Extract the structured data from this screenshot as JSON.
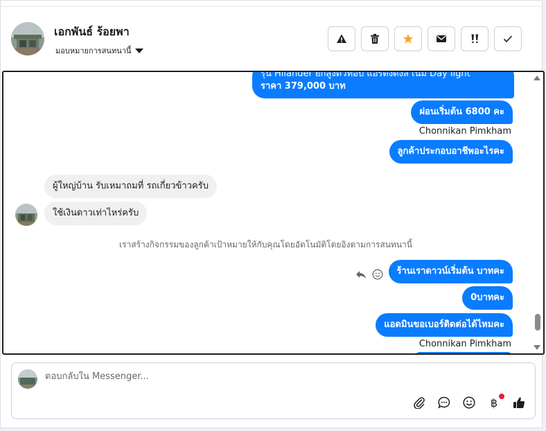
{
  "contact": {
    "name": "เอกพันธ์ ร้อยพา",
    "assign_label": "มอบหมายการสนทนานี้"
  },
  "actions": [
    {
      "name": "report-button",
      "icon": "warning-icon"
    },
    {
      "name": "delete-button",
      "icon": "trash-icon"
    },
    {
      "name": "star-button",
      "icon": "star-icon",
      "color": "#f5a623"
    },
    {
      "name": "mark-unread-button",
      "icon": "envelope-icon"
    },
    {
      "name": "follow-up-button",
      "icon": "double-exclamation-icon"
    },
    {
      "name": "mark-done-button",
      "icon": "checkmark-icon"
    }
  ],
  "messages": {
    "m1_line1": "รุ่น Hilander ยกสูงตัวท็อป แอร์ดงดังส์ เน้ม Day light",
    "m1_line2": "ราคา 379,000 บาท",
    "m2": "ผ่อนเริ่มต้น 6800 คะ",
    "sender1": "Chonnikan Pimkham",
    "m3": "ลูกค้าประกอบอาชีพอะไรคะ",
    "m4": "ผู้ใหญ่บ้าน   รับเหมาถมที่  รถเกี่ยวข้าวครับ",
    "m5": "ใช้เงินดาวเท่าไหร่ครับ",
    "system": "เราสร้างกิจกรรมของลูกค้าเป้าหมายให้กับคุณโดยอัตโนมัติโดยอิงตามการสนทนานี้",
    "m6": "ร้านเราดาวน์เริ่มต้น  บาทคะ",
    "m7": "0บาทคะ",
    "m8": "แอดมินขอเบอร์ติดต่อได้ไหมคะ",
    "sender2": "Chonnikan Pimkham"
  },
  "composer": {
    "placeholder": "ตอบกลับใน Messenger...",
    "tools": [
      "attachment-icon",
      "saved-reply-icon",
      "emoji-icon",
      "payment-icon",
      "like-icon"
    ],
    "payment_symbol": "฿",
    "notification_dot_color": "#e41e3f"
  },
  "colors": {
    "outgoing_bubble": "#0a7cff",
    "incoming_bubble": "#f0f0f0"
  }
}
